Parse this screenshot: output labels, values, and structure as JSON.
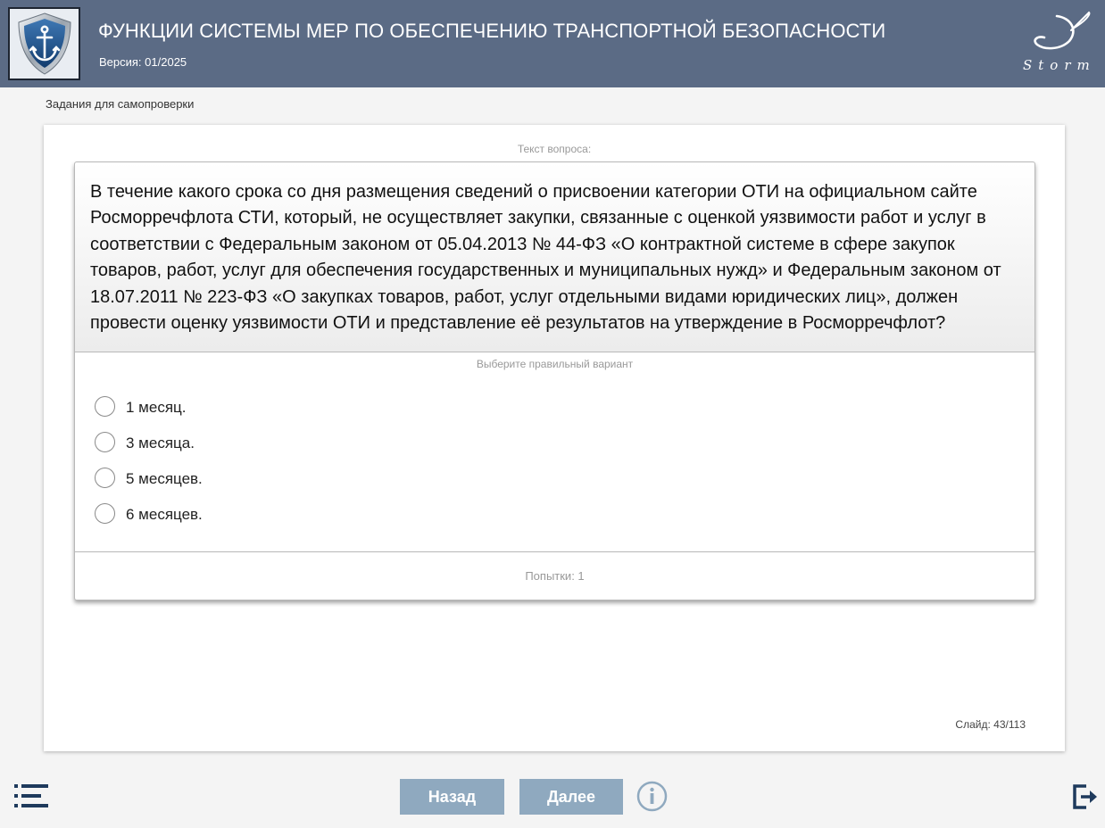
{
  "header": {
    "title": "ФУНКЦИИ СИСТЕМЫ МЕР ПО ОБЕСПЕЧЕНИЮ ТРАНСПОРТНОЙ БЕЗОПАСНОСТИ",
    "version": "Версия: 01/2025",
    "logo_icon": "anchor-shield-icon",
    "brand_logo_text": "Storm"
  },
  "breadcrumb": "Задания для самопроверки",
  "question": {
    "caption": "Текст вопроса:",
    "text": "В течение какого срока со дня размещения сведений о присвоении категории ОТИ на официальном сайте Росморречфлота СТИ, который, не осуществляет закупки, связанные с оценкой уязвимости работ и услуг в соответствии с Федеральным законом от 05.04.2013 № 44-ФЗ «О контрактной системе в сфере закупок товаров, работ, услуг для обеспечения государственных и муниципальных нужд» и Федеральным законом от 18.07.2011 № 223-ФЗ «О закупках товаров, работ, услуг отдельными видами юридических лиц», должен провести оценку уязвимости ОТИ и представление её результатов на утверждение в Росморречфлот?",
    "choose_caption": "Выберите правильный вариант",
    "options": [
      {
        "label": "1 месяц."
      },
      {
        "label": "3 месяца."
      },
      {
        "label": "5 месяцев."
      },
      {
        "label": "6 месяцев."
      }
    ],
    "attempts": "Попытки: 1"
  },
  "slide": {
    "label": "Слайд:",
    "current": "43",
    "separator": "/",
    "total": "113"
  },
  "footer": {
    "menu_icon": "list-menu-icon",
    "back_label": "Назад",
    "next_label": "Далее",
    "info_icon": "info-icon",
    "exit_icon": "exit-icon"
  },
  "colors": {
    "header_bg": "#5b6b85",
    "button_bg": "#8fa9bf",
    "icon_dark": "#1e3a5c",
    "info_icon": "#8fa9bf"
  }
}
